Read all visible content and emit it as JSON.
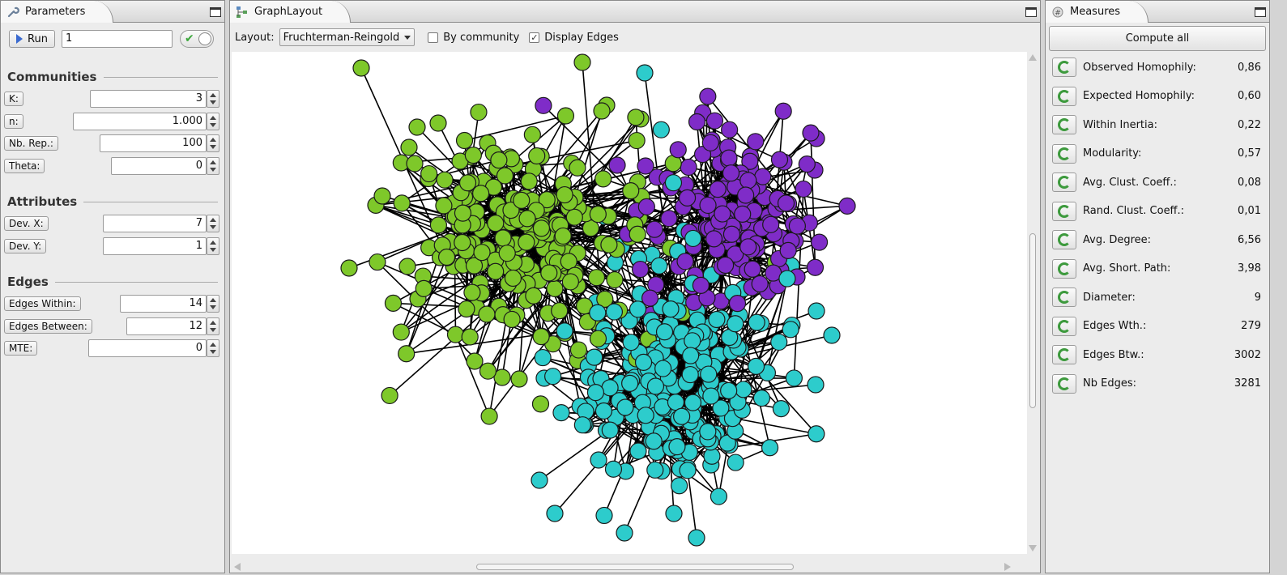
{
  "parameters": {
    "tab_title": "Parameters",
    "run_label": "Run",
    "run_value": "1",
    "sections": {
      "communities": "Communities",
      "attributes": "Attributes",
      "edges": "Edges"
    },
    "fields": [
      {
        "label": "K:",
        "value": "3"
      },
      {
        "label": "n:",
        "value": "1.000"
      },
      {
        "label": "Nb. Rep.:",
        "value": "100"
      },
      {
        "label": "Theta:",
        "value": "0"
      },
      {
        "label": "Dev. X:",
        "value": "7"
      },
      {
        "label": "Dev. Y:",
        "value": "1"
      },
      {
        "label": "Edges Within:",
        "value": "14"
      },
      {
        "label": "Edges Between:",
        "value": "12"
      },
      {
        "label": "MTE:",
        "value": "0"
      }
    ]
  },
  "graph": {
    "tab_title": "GraphLayout",
    "layout_label": "Layout:",
    "layout_value": "Fruchterman-Reingold",
    "by_community_label": "By community",
    "display_edges_label": "Display Edges",
    "community_colors": {
      "green": "#7ec82a",
      "purple": "#7f2cc8",
      "cyan": "#2dcccc"
    }
  },
  "measures": {
    "tab_title": "Measures",
    "compute_all_label": "Compute all",
    "items": [
      {
        "label": "Observed Homophily:",
        "value": "0,86"
      },
      {
        "label": "Expected Homophily:",
        "value": "0,60"
      },
      {
        "label": "Within Inertia:",
        "value": "0,22"
      },
      {
        "label": "Modularity:",
        "value": "0,57"
      },
      {
        "label": "Avg. Clust. Coeff.:",
        "value": "0,08"
      },
      {
        "label": "Rand. Clust. Coeff.:",
        "value": "0,01"
      },
      {
        "label": "Avg. Degree:",
        "value": "6,56"
      },
      {
        "label": "Avg. Short. Path:",
        "value": "3,98"
      },
      {
        "label": "Diameter:",
        "value": "9"
      },
      {
        "label": "Edges Wth.:",
        "value": "279"
      },
      {
        "label": "Edges Btw.:",
        "value": "3002"
      },
      {
        "label": "Nb Edges:",
        "value": "3281"
      }
    ]
  }
}
